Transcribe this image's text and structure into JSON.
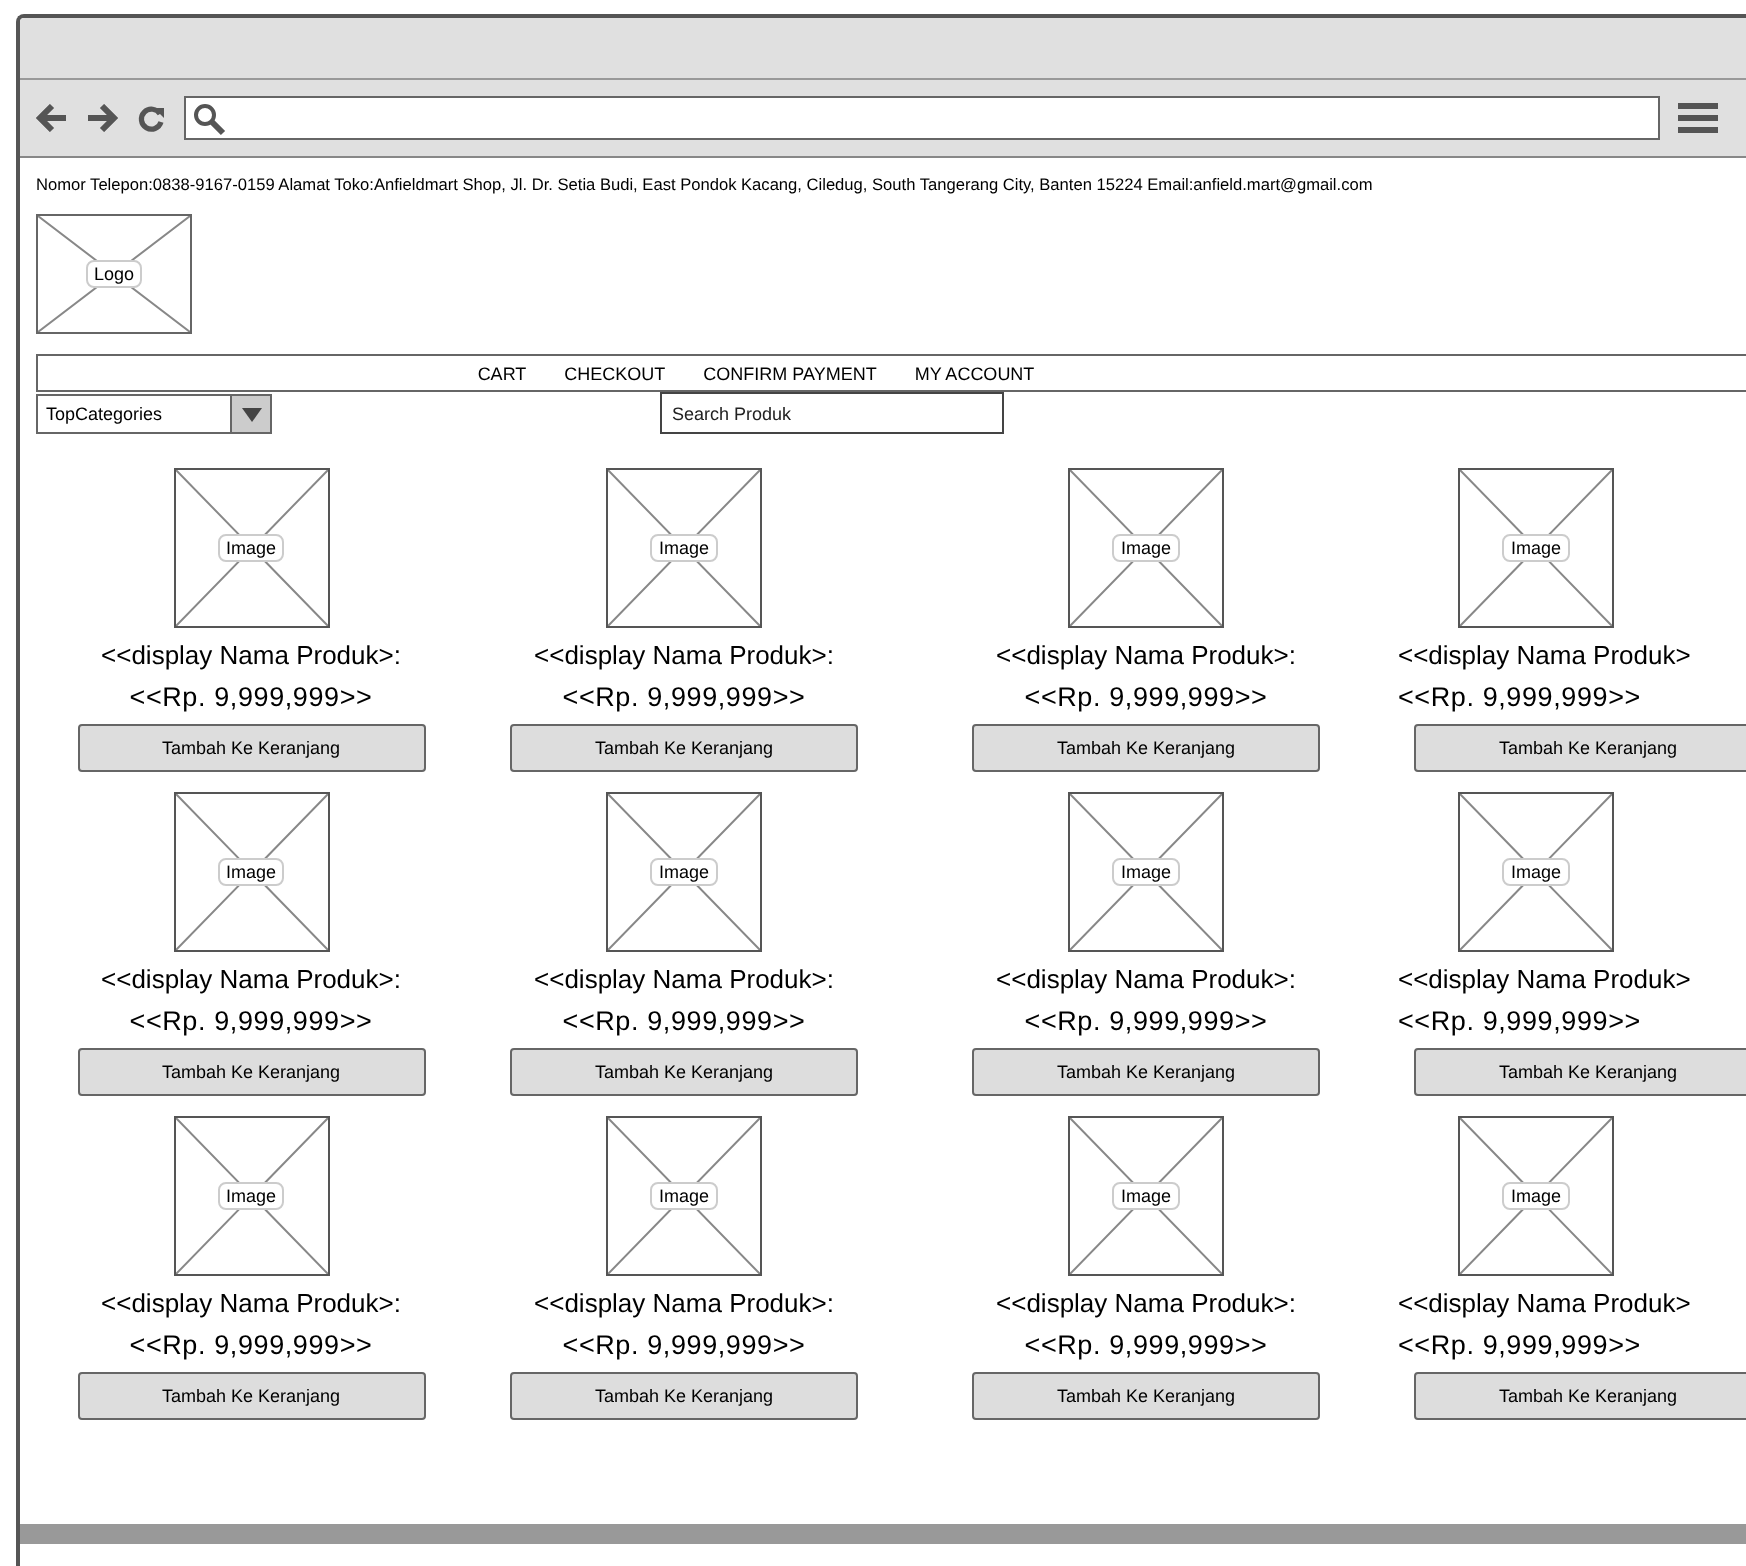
{
  "contact_bar": "Nomor Telepon:0838-9167-0159 Alamat Toko:Anfieldmart Shop, Jl. Dr. Setia Budi, East Pondok Kacang, Ciledug, South Tangerang City, Banten 15224 Email:anfield.mart@gmail.com",
  "logo": {
    "label": "Logo"
  },
  "nav": [
    "CART",
    "CHECKOUT",
    "CONFIRM PAYMENT",
    "MY ACCOUNT"
  ],
  "category_dropdown": {
    "value": "TopCategories"
  },
  "search": {
    "placeholder": "Search Produk"
  },
  "products": [
    {
      "image_label": "Image",
      "name": "<<display Nama Produk>:",
      "price": "<<Rp. 9,999,999>>",
      "button": "Tambah Ke Keranjang"
    },
    {
      "image_label": "Image",
      "name": "<<display Nama Produk>:",
      "price": "<<Rp. 9,999,999>>",
      "button": "Tambah Ke Keranjang"
    },
    {
      "image_label": "Image",
      "name": "<<display Nama Produk>:",
      "price": "<<Rp. 9,999,999>>",
      "button": "Tambah Ke Keranjang"
    },
    {
      "image_label": "Image",
      "name": "<<display Nama Produk>",
      "price": "<<Rp. 9,999,999>>",
      "button": "Tambah Ke Keranjang"
    },
    {
      "image_label": "Image",
      "name": "<<display Nama Produk>:",
      "price": "<<Rp. 9,999,999>>",
      "button": "Tambah Ke Keranjang"
    },
    {
      "image_label": "Image",
      "name": "<<display Nama Produk>:",
      "price": "<<Rp. 9,999,999>>",
      "button": "Tambah Ke Keranjang"
    },
    {
      "image_label": "Image",
      "name": "<<display Nama Produk>:",
      "price": "<<Rp. 9,999,999>>",
      "button": "Tambah Ke Keranjang"
    },
    {
      "image_label": "Image",
      "name": "<<display Nama Produk>",
      "price": "<<Rp. 9,999,999>>",
      "button": "Tambah Ke Keranjang"
    },
    {
      "image_label": "Image",
      "name": "<<display Nama Produk>:",
      "price": "<<Rp. 9,999,999>>",
      "button": "Tambah Ke Keranjang"
    },
    {
      "image_label": "Image",
      "name": "<<display Nama Produk>:",
      "price": "<<Rp. 9,999,999>>",
      "button": "Tambah Ke Keranjang"
    },
    {
      "image_label": "Image",
      "name": "<<display Nama Produk>:",
      "price": "<<Rp. 9,999,999>>",
      "button": "Tambah Ke Keranjang"
    },
    {
      "image_label": "Image",
      "name": "<<display Nama Produk>",
      "price": "<<Rp. 9,999,999>>",
      "button": "Tambah Ke Keranjang"
    }
  ]
}
